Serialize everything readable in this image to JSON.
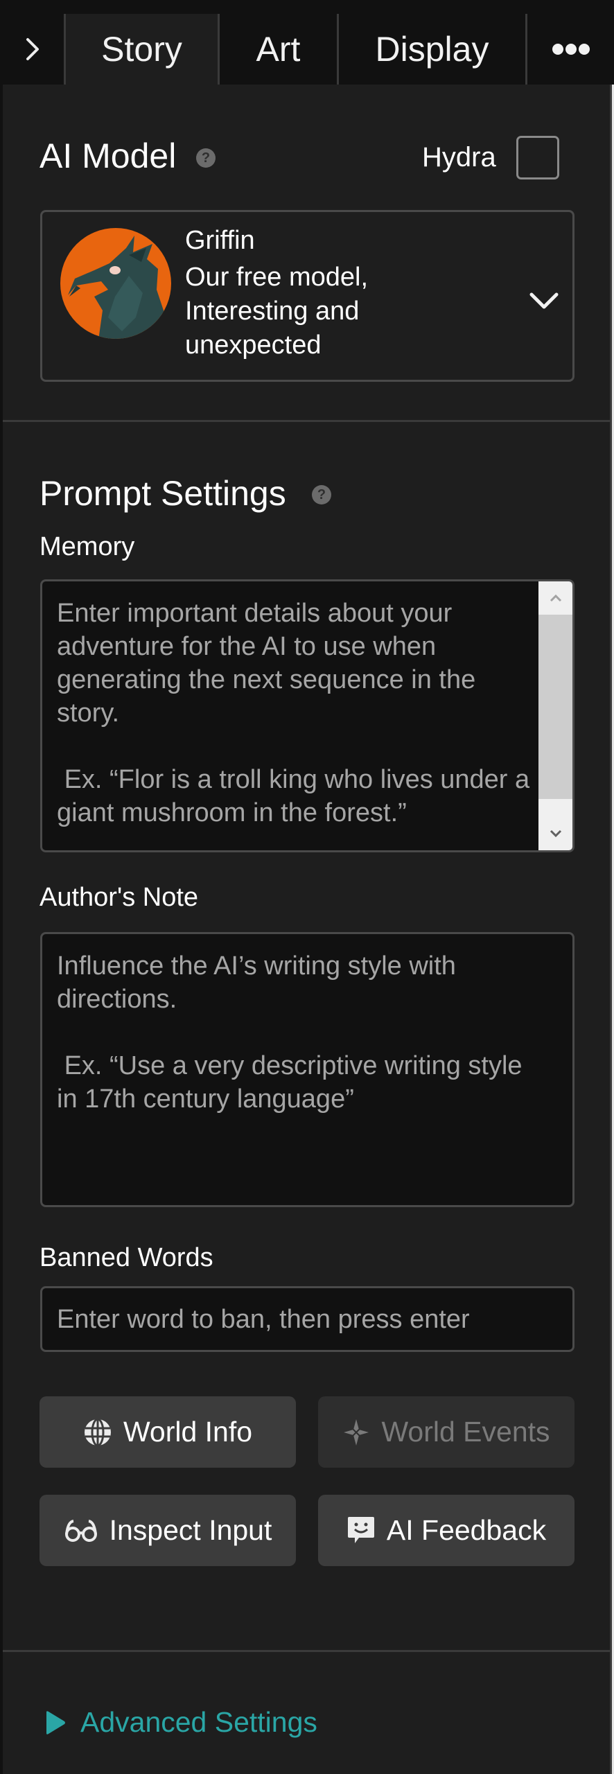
{
  "tabs": {
    "collapse_icon": "chevron-right-icon",
    "items": [
      {
        "label": "Story",
        "active": true
      },
      {
        "label": "Art",
        "active": false
      },
      {
        "label": "Display",
        "active": false
      }
    ],
    "more_icon": "more-horizontal-icon"
  },
  "ai_model": {
    "title": "AI Model",
    "help_icon": "help-circle-icon",
    "hydra_label": "Hydra",
    "hydra_checked": false,
    "selected": {
      "name": "Griffin",
      "description": "Our free model, Interesting and unexpected",
      "avatar_color": "#e8650f"
    }
  },
  "prompt_settings": {
    "title": "Prompt Settings",
    "help_icon": "help-circle-icon",
    "memory": {
      "label": "Memory",
      "value": "",
      "placeholder": "Enter important details about your adventure for the AI to use when generating the next sequence in the story.\n\n Ex. “Flor is a troll king who lives under a giant mushroom in the forest.”"
    },
    "authors_note": {
      "label": "Author's Note",
      "value": "",
      "placeholder": "Influence the AI’s writing style with directions.\n\n Ex. “Use a very descriptive writing style in 17th century language”"
    },
    "banned_words": {
      "label": "Banned Words",
      "value": "",
      "placeholder": "Enter word to ban, then press enter"
    }
  },
  "buttons": {
    "world_info": {
      "label": "World Info",
      "icon": "globe-icon",
      "enabled": true
    },
    "world_events": {
      "label": "World Events",
      "icon": "sparkle-icon",
      "enabled": false
    },
    "inspect_input": {
      "label": "Inspect Input",
      "icon": "glasses-icon",
      "enabled": true
    },
    "ai_feedback": {
      "label": "AI Feedback",
      "icon": "feedback-smile-icon",
      "enabled": true
    }
  },
  "advanced_settings": {
    "label": "Advanced Settings",
    "expanded": false,
    "color": "#2aa6a6"
  }
}
